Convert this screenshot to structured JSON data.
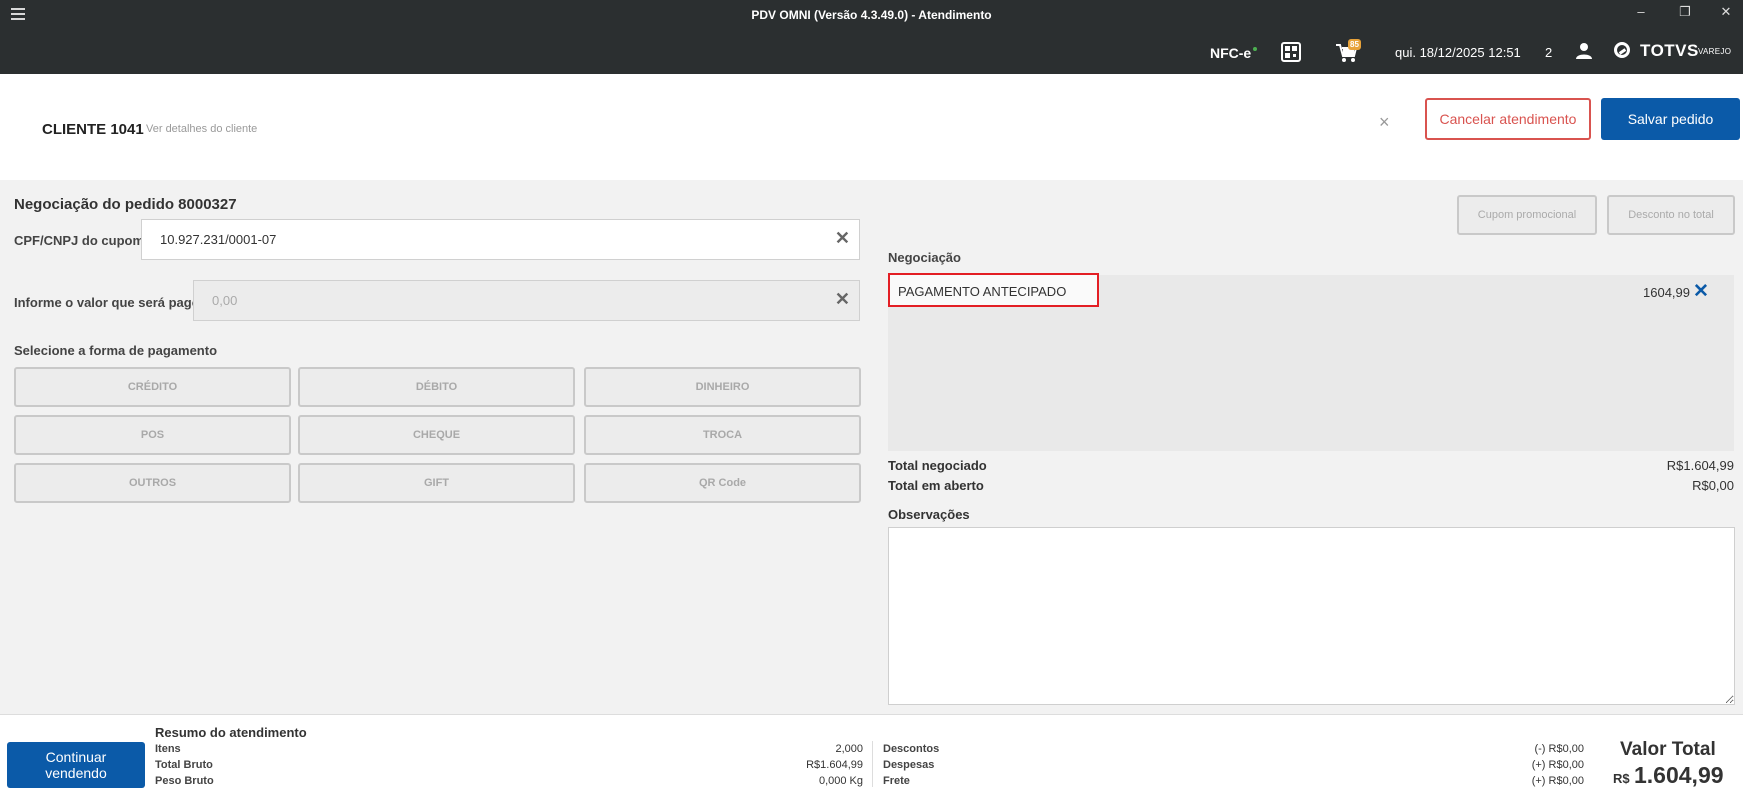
{
  "window": {
    "title": "PDV OMNI (Versão 4.3.49.0) - Atendimento",
    "minimize": "–",
    "maximize": "❐",
    "close": "✕"
  },
  "header": {
    "nfce": "NFC-e",
    "cart_badge": "85",
    "datetime": "qui. 18/12/2025 12:51",
    "user_count": "2",
    "brand": "TOTVS",
    "brand_sub": "VAREJO"
  },
  "client": {
    "name": "CLIENTE 1041",
    "details_link": "Ver detalhes do cliente",
    "close": "×",
    "cancel_label": "Cancelar atendimento",
    "save_label": "Salvar pedido"
  },
  "negotiation": {
    "title": "Negociação do pedido 8000327",
    "cpf_label": "CPF/CNPJ do cupom",
    "cpf_value": "10.927.231/0001-07",
    "amount_label": "Informe o valor que será pago",
    "amount_value": "0,00",
    "clear": "✕",
    "payment_label": "Selecione a forma de pagamento",
    "payment_methods": [
      "CRÉDITO",
      "DÉBITO",
      "DINHEIRO",
      "POS",
      "CHEQUE",
      "TROCA",
      "OUTROS",
      "GIFT",
      "QR Code"
    ]
  },
  "right": {
    "coupon_button": "Cupom promocional",
    "discount_button": "Desconto no total",
    "negotiation_title": "Negociação",
    "item_label": "PAGAMENTO ANTECIPADO",
    "item_value": "1604,99",
    "item_remove": "✕",
    "total_negotiated_label": "Total negociado",
    "total_negotiated_value": "R$1.604,99",
    "total_open_label": "Total em aberto",
    "total_open_value": "R$0,00",
    "observations_label": "Observações"
  },
  "footer": {
    "continue_label": "Continuar vendendo",
    "summary_title": "Resumo do atendimento",
    "items_label": "Itens",
    "items_value": "2,000",
    "gross_label": "Total Bruto",
    "gross_value": "R$1.604,99",
    "weight_label": "Peso Bruto",
    "weight_value": "0,000 Kg",
    "discounts_label": "Descontos",
    "discounts_value": "(-) R$0,00",
    "expenses_label": "Despesas",
    "expenses_value": "(+) R$0,00",
    "freight_label": "Frete",
    "freight_value": "(+) R$0,00",
    "total_label": "Valor Total",
    "total_currency": "R$",
    "total_value": "1.604,99"
  }
}
